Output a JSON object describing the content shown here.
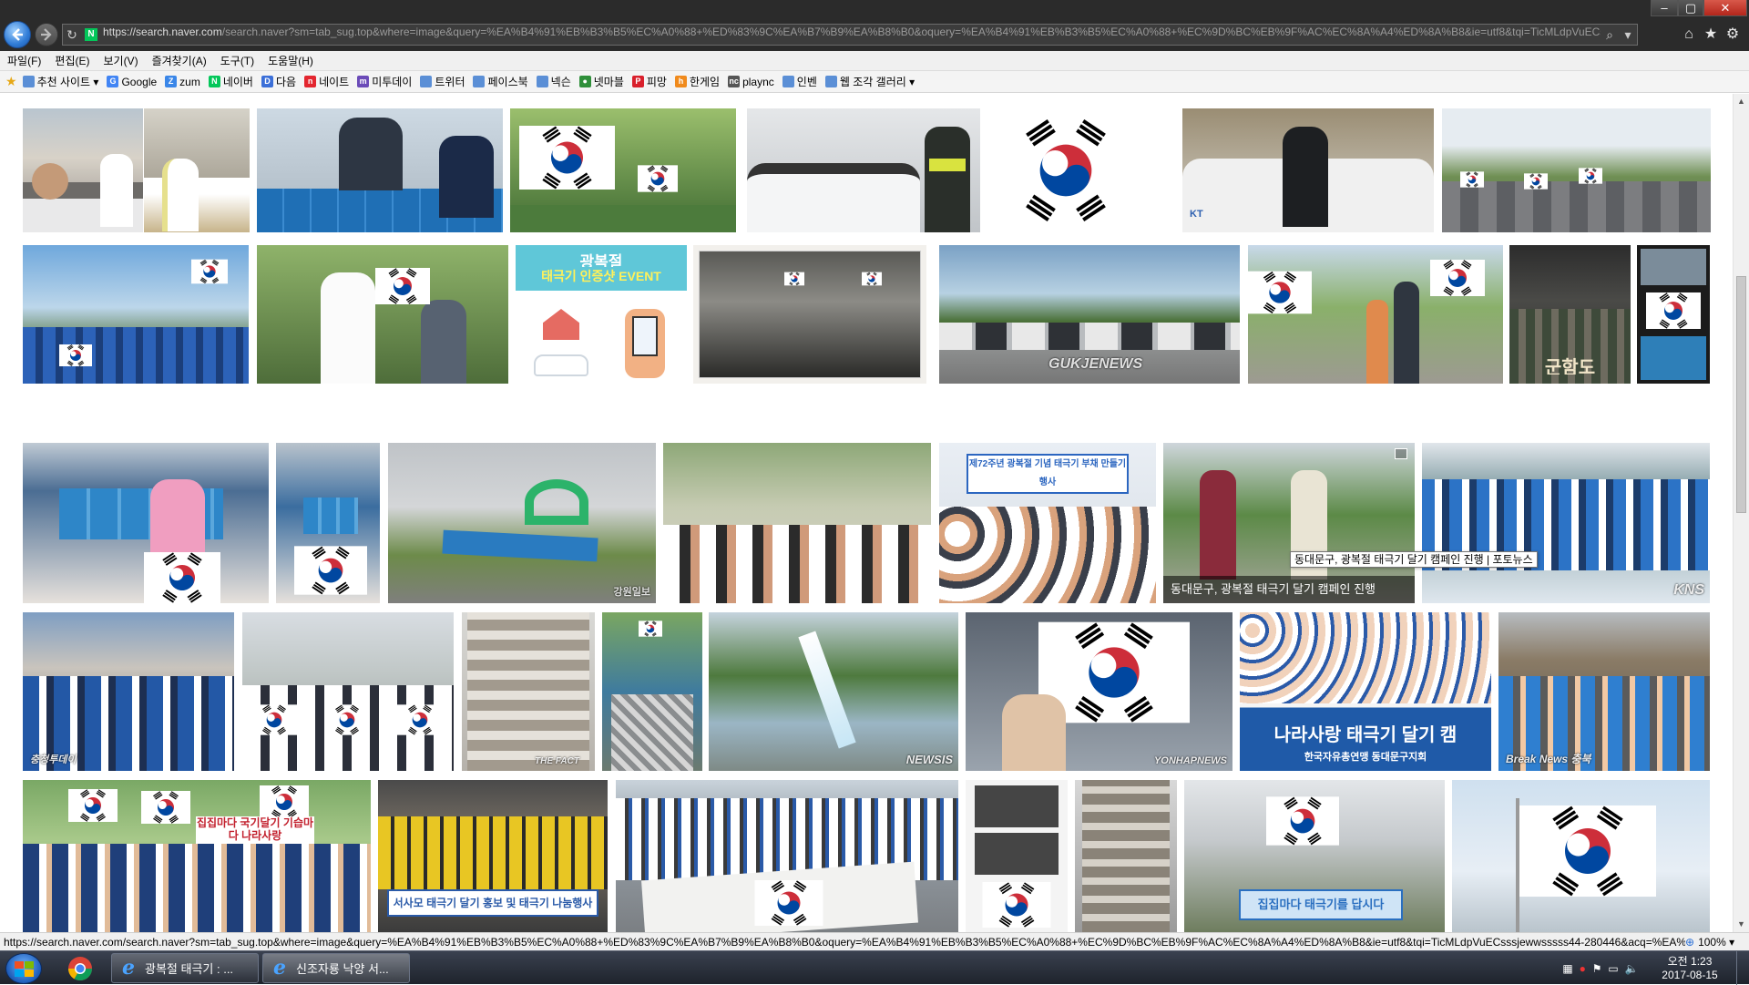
{
  "window": {
    "controls": {
      "minimize": "‒",
      "maximize": "▢",
      "close": "✕"
    }
  },
  "address": {
    "url_host": "https://search.naver.com",
    "url_rest": "/search.naver?sm=tab_sug.top&where=image&query=%EA%B4%91%EB%B3%B5%EC%A0%88+%ED%83%9C%EA%B7%B9%EA%B8%B0&oquery=%EA%B4%91%EB%B3%B5%EC%A0%88+%EC%9D%BC%EB%9F%AC%EC%8A%A4%ED%8A%B8&ie=utf8&tqi=TicMLdpVuECsssjewwsssss4"
  },
  "menu": [
    "파일(F)",
    "편집(E)",
    "보기(V)",
    "즐겨찾기(A)",
    "도구(T)",
    "도움말(H)"
  ],
  "favorites": [
    {
      "label": "추천 사이트 ▾",
      "icon": "page-icon",
      "color": "#5b8fd6",
      "glyph": ""
    },
    {
      "label": "Google",
      "icon": "google-icon",
      "color": "#4285f4",
      "glyph": "G"
    },
    {
      "label": "zum",
      "icon": "zum-icon",
      "color": "#3a86e8",
      "glyph": "Z"
    },
    {
      "label": "네이버",
      "icon": "naver-icon",
      "color": "#03c75a",
      "glyph": "N"
    },
    {
      "label": "다음",
      "icon": "daum-icon",
      "color": "#3b6fd8",
      "glyph": "D"
    },
    {
      "label": "네이트",
      "icon": "nate-icon",
      "color": "#e3262f",
      "glyph": "n"
    },
    {
      "label": "미투데이",
      "icon": "metoday-icon",
      "color": "#6b4bb8",
      "glyph": "m"
    },
    {
      "label": "트위터",
      "icon": "page-icon",
      "color": "#5b8fd6",
      "glyph": ""
    },
    {
      "label": "페이스북",
      "icon": "page-icon",
      "color": "#5b8fd6",
      "glyph": ""
    },
    {
      "label": "넥슨",
      "icon": "page-icon",
      "color": "#5b8fd6",
      "glyph": ""
    },
    {
      "label": "넷마블",
      "icon": "globe-icon",
      "color": "#2f8f3a",
      "glyph": "●"
    },
    {
      "label": "피망",
      "icon": "pmang-icon",
      "color": "#d9202c",
      "glyph": "P"
    },
    {
      "label": "한게임",
      "icon": "hangame-icon",
      "color": "#f08a1c",
      "glyph": "h"
    },
    {
      "label": "plaync",
      "icon": "plaync-icon",
      "color": "#555555",
      "glyph": "nc"
    },
    {
      "label": "인벤",
      "icon": "page-icon",
      "color": "#5b8fd6",
      "glyph": ""
    },
    {
      "label": "웹 조각 갤러리 ▾",
      "icon": "page-icon",
      "color": "#5b8fd6",
      "glyph": ""
    }
  ],
  "content": {
    "watermarks": {
      "yonhap1": "YONHAPNEWS",
      "gukje": "GUKJENEWS",
      "gangwon": "강원일보",
      "kns": "KNS",
      "chungjeong": "충청투데이",
      "thefact": "THE FACT",
      "newsis": "NEWSIS",
      "yonhap2": "YONHAPNEWS",
      "breaknews": "Break News 충북"
    },
    "banners": {
      "event_title": "광복절",
      "event_sub": "태극기 인증샷 EVENT",
      "movie_title": "군함도",
      "campaign_banner": "제72주년 광복절 기념 태극기 부채 만들기 행사",
      "nara_banner": "나라사랑 태극기 달기 캠",
      "nara_sub": "한국자유총연맹 동대문구지회",
      "seosamo_banner": "서사모 태극기 달기 홍보 및 태극기 나눔행사",
      "jipjip_banner": "집집마다 국기달기 기습마다 나라사랑",
      "jipjip_banner_2": "집집마다 태극기를 답시다"
    },
    "caption": "동대문구, 광복절 태극기 달기 캠페인 진행",
    "tooltip": "동대문구, 광복절 태극기 달기 캠페인 진행 | 포토뉴스"
  },
  "status": {
    "url": "https://search.naver.com/search.naver?sm=tab_sug.top&where=image&query=%EA%B4%91%EB%B3%B5%EC%A0%88+%ED%83%9C%EA%B7%B9%EA%B8%B0&oquery=%EA%B4%91%EB%B3%B5%EC%A0%88+%EC%9D%BC%EB%9F%AC%EC%8A%A4%ED%8A%B8&ie=utf8&tqi=TicMLdpVuECsssjewwsssss44-280446&acq=%EA%B4%91%EB",
    "zoom": "100%"
  },
  "taskbar": {
    "tasks": [
      "광복절 태극기 : ...",
      "신조자룡 낙양 서..."
    ],
    "clock_time": "오전 1:23",
    "clock_date": "2017-08-15"
  },
  "colors": {
    "flag_red": "#cd2e3a",
    "flag_blue": "#0047a0",
    "chrome_dark": "#2b2b2b"
  }
}
